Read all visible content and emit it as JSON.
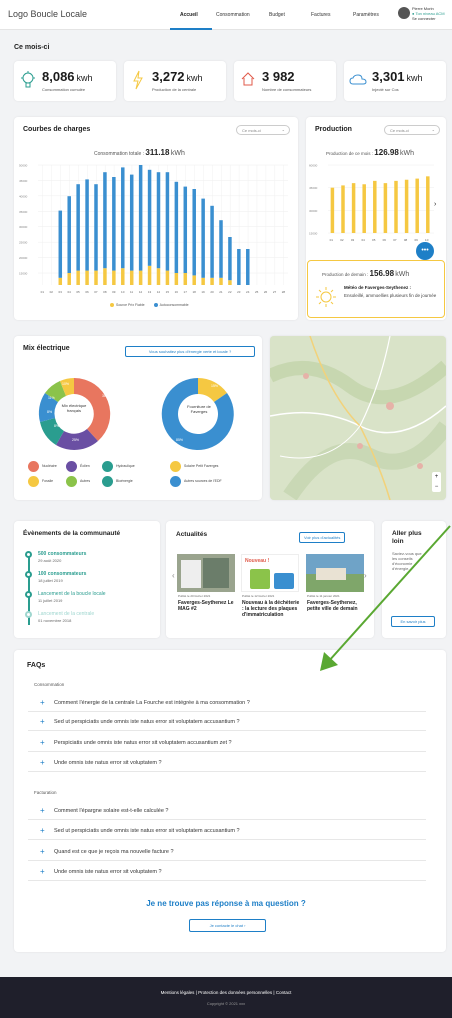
{
  "header": {
    "logo": "Logo Boucle Locale",
    "nav": [
      "Accueil",
      "Consommation",
      "Budget",
      "Factures",
      "Paramètres"
    ],
    "user_name": "Pierre Morin",
    "user_status": "● Ton niveau ACM",
    "user_sub": "Se connecter"
  },
  "month": {
    "title": "Ce mois-ci",
    "kpis": [
      {
        "icon": "bulb-icon",
        "value": "8,086",
        "unit": "kwh",
        "label": "Consommation cumulée"
      },
      {
        "icon": "bolt-icon",
        "value": "3,272",
        "unit": "kwh",
        "label": "Production de la centrale"
      },
      {
        "icon": "home-icon",
        "value": "3 982",
        "unit": "",
        "label": "Nombre de consommateurs"
      },
      {
        "icon": "cloud-icon",
        "value": "3,301",
        "unit": "kwh",
        "label": "Injecté sur Cos"
      }
    ]
  },
  "load_curves": {
    "title": "Courbes de charges",
    "select": "Ce mois-ci",
    "subtitle": "Consommation totale :",
    "total": "311.18",
    "total_unit": "kWh",
    "legend": [
      "Source Prix Fiable",
      "Autoconsommable"
    ]
  },
  "production": {
    "title": "Production",
    "select": "Ce mois-ci",
    "subtitle": "Production de ce mois :",
    "total": "126.98",
    "total_unit": "kWh",
    "today_label": "Production de demain :",
    "today_value": "156.98",
    "today_unit": "kWh",
    "weather_title": "Météo de Faverges-Seythenez :",
    "weather_text": "Ensoleillé, ammoellies plusieurs fin de journée"
  },
  "chart_data": [
    {
      "type": "bar",
      "categories": [
        "01",
        "02",
        "03",
        "04",
        "05",
        "06",
        "07",
        "08",
        "09",
        "10",
        "11",
        "12",
        "13",
        "14",
        "15",
        "16",
        "17",
        "18",
        "19",
        "20",
        "21",
        "22",
        "23",
        "24",
        "25",
        "26",
        "27",
        "28"
      ],
      "series": [
        {
          "name": "Source Prix Fiable",
          "values": [
            0,
            0,
            3,
            5,
            6,
            6,
            6,
            7,
            6,
            7,
            6,
            6,
            8,
            7,
            6,
            5,
            5,
            4,
            3,
            3,
            3,
            2,
            0,
            0,
            0,
            0,
            0,
            0
          ]
        },
        {
          "name": "Autoconsommable",
          "values": [
            0,
            0,
            28,
            32,
            36,
            38,
            36,
            40,
            39,
            42,
            40,
            44,
            40,
            40,
            41,
            38,
            36,
            36,
            33,
            30,
            24,
            18,
            15,
            15,
            0,
            0,
            0,
            0
          ]
        }
      ],
      "ylim": [
        0,
        50
      ],
      "yticks": [
        "50000",
        "45000",
        "40000",
        "35000",
        "30000",
        "25000",
        "20000",
        "15000"
      ]
    },
    {
      "type": "bar",
      "categories": [
        "01",
        "02",
        "03",
        "04",
        "05",
        "06",
        "07",
        "08",
        "09",
        "10"
      ],
      "values": [
        40,
        42,
        44,
        43,
        46,
        44,
        46,
        47,
        48,
        50
      ],
      "ylim": [
        0,
        60
      ],
      "yticks": [
        "60000",
        "45000",
        "30000",
        "15000"
      ]
    }
  ],
  "mix": {
    "title": "Mix électrique",
    "button": "Vous souhaitez plus d'énergie verte et locale ?",
    "donut1_center": "Mix électrique français",
    "donut1_labels": [
      "38%",
      "10%",
      "8%",
      "25%",
      "11%",
      "8%"
    ],
    "donut2_center": "Fourniture de Faverges",
    "donut2_labels": [
      "15%",
      "85%"
    ],
    "legend": [
      "Nucléaire",
      "Éolien",
      "Hydraulique",
      "Fossile",
      "Autres",
      "Bioénergie",
      "Solaire Petit Faverges",
      "Autres sources de l'EDF"
    ]
  },
  "events": {
    "title": "Évènements de la communauté",
    "items": [
      {
        "title": "500 consommateurs",
        "date": "29 août 2020"
      },
      {
        "title": "100 consommateurs",
        "date": "18 juillet 2019"
      },
      {
        "title": "Lancement de la boucle locale",
        "date": "11 juillet 2019"
      },
      {
        "title": "Lancement de la centrale",
        "date": "01 novembre 2018"
      }
    ]
  },
  "news": {
    "title": "Actualités",
    "button": "Voir plus d'actualités",
    "items": [
      {
        "date": "Publié le 20 février 2021",
        "title": "Faverges-Seythenez Le MAG #2"
      },
      {
        "date": "Publié le 12 février 2021",
        "title": "Nouveau à la déchèterie : la lecture des plaques d'immatriculation"
      },
      {
        "date": "Publié le 11 janvier 2021",
        "title": "Faverges-Seythenez, petite ville de demain"
      }
    ],
    "nouveau_badge": "Nouveau !"
  },
  "further": {
    "title": "Aller plus loin",
    "text": "Saviez-vous que les conseils d'économie d'énergie...",
    "button": "En savoir plus"
  },
  "faq": {
    "title": "FAQs",
    "group1": "Consommation",
    "q1": [
      "Comment l'énergie de la centrale La Fourche est intégrée à ma consommation ?",
      "Sed ut perspiciatis unde omnis iste natus error sit voluptatem accusantium ?",
      "Perspiciatis unde omnis iste natus error sit voluptatem accusantium zet ?",
      "Unde omnis iste natus error sit voluptatem ?"
    ],
    "group2": "Facturation",
    "q2": [
      "Comment l'épargne solaire est-t-elle calculée ?",
      "Sed ut perspiciatis unde omnis iste natus error sit voluptatem accusantium ?",
      "Quand est ce que je reçois ma nouvelle facture ?",
      "Unde omnis iste natus error sit voluptatem ?"
    ],
    "no_answer": "Je ne trouve pas réponse à ma question ?",
    "contact_button": "Je contacte le chat"
  },
  "footer": {
    "links": "Mentions légales | Protection des données personnelles | Contact",
    "copyright": "Copyright © 2021 xxx"
  },
  "colors": {
    "blue": "#3a8fd0",
    "yellow": "#f5c842",
    "teal": "#2a9d8f",
    "accent": "#1e7fc7",
    "green_arrow": "#5aa832"
  }
}
